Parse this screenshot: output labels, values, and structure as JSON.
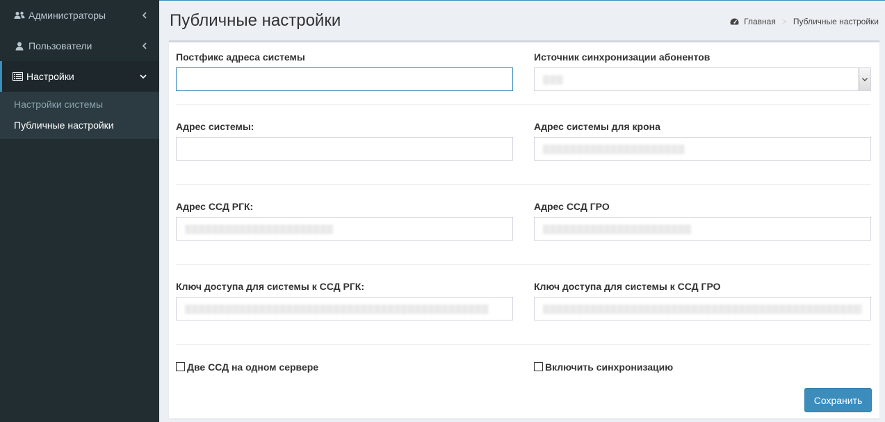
{
  "sidebar": {
    "items": [
      {
        "label": "Администраторы",
        "icon": "users-icon",
        "chevron": "chevron-left-icon"
      },
      {
        "label": "Пользователи",
        "icon": "user-icon",
        "chevron": "chevron-left-icon"
      },
      {
        "label": "Настройки",
        "icon": "list-icon",
        "chevron": "chevron-down-icon"
      }
    ],
    "submenu": [
      {
        "label": "Настройки системы"
      },
      {
        "label": "Публичные настройки"
      }
    ]
  },
  "header": {
    "title": "Публичные настройки",
    "breadcrumb": {
      "home": "Главная",
      "current": "Публичные настройки"
    }
  },
  "form": {
    "postfix": {
      "label": "Постфикс адреса системы",
      "value": ""
    },
    "sync_source": {
      "label": "Источник синхронизации абонентов",
      "value": "▒▒▒"
    },
    "address": {
      "label": "Адрес системы:",
      "value": ""
    },
    "cron_address": {
      "label": "Адрес системы для крона",
      "value": "▒▒▒▒▒▒▒▒▒▒▒▒▒▒▒▒▒▒▒▒▒"
    },
    "ssd_rgk": {
      "label": "Адрес ССД РГК:",
      "value": "▒▒▒▒▒▒▒▒▒▒▒▒▒▒▒▒▒▒▒▒▒▒"
    },
    "ssd_gro": {
      "label": "Адрес ССД ГРО",
      "value": "▒▒▒▒▒▒▒▒▒▒▒▒▒▒▒▒▒▒▒▒▒▒"
    },
    "key_rgk": {
      "label": "Ключ доступа для системы к ССД РГК:",
      "value": "▒▒▒▒▒▒▒▒▒▒▒▒▒▒▒▒▒▒▒▒▒▒▒▒▒▒▒▒▒▒▒▒▒▒▒▒▒▒▒▒▒▒▒▒▒"
    },
    "key_gro": {
      "label": "Ключ доступа для системы к ССД ГРО",
      "value": "▒▒▒▒▒▒▒▒▒▒▒▒▒▒▒▒▒▒▒▒▒▒▒▒▒▒▒▒▒▒▒▒▒▒▒▒▒▒▒▒▒▒▒▒▒▒▒▒"
    },
    "two_ssd": {
      "label": "Две ССД на одном сервере",
      "checked": false
    },
    "enable_sync": {
      "label": "Включить синхронизацию",
      "checked": false
    },
    "save_label": "Сохранить"
  },
  "colors": {
    "sidebar_bg": "#222d32",
    "accent": "#3c8dbc",
    "content_bg": "#ecf0f5"
  }
}
